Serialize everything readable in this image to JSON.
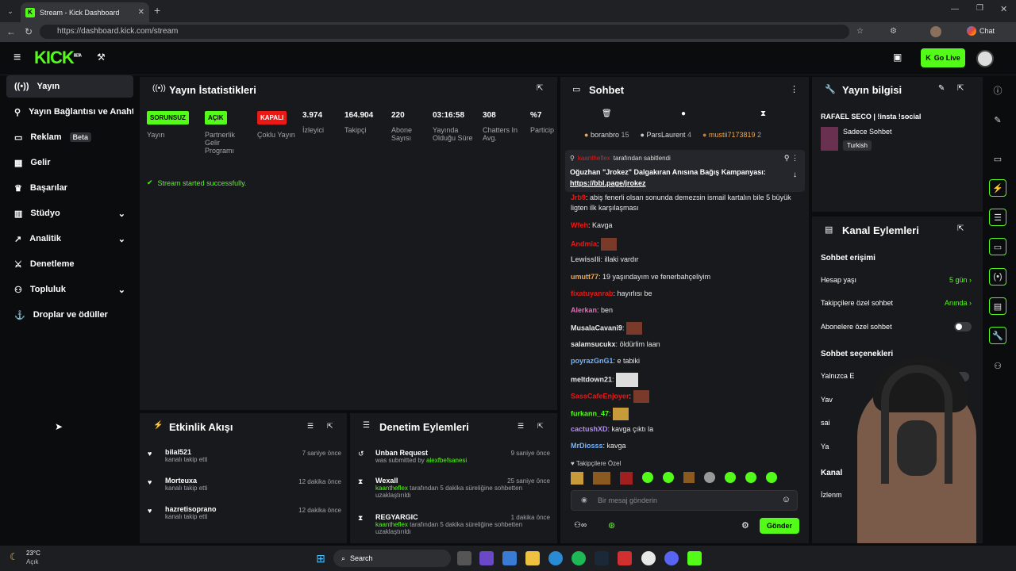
{
  "browser": {
    "tab_title": "Stream - Kick Dashboard",
    "url": "https://dashboard.kick.com/stream",
    "chat_label": "Chat"
  },
  "header": {
    "logo": "KICK",
    "logo_sup": "BETA",
    "go_live": "Go Live"
  },
  "sidebar": {
    "items": [
      {
        "label": "Yayın",
        "icon": "broadcast-icon"
      },
      {
        "label": "Yayın Bağlantısı ve Anahtarı",
        "icon": "link-icon"
      },
      {
        "label": "Reklam",
        "icon": "ad-icon",
        "badge": "Beta"
      },
      {
        "label": "Gelir",
        "icon": "revenue-icon"
      },
      {
        "label": "Başarılar",
        "icon": "trophy-icon"
      },
      {
        "label": "Stüdyo",
        "icon": "studio-icon"
      },
      {
        "label": "Analitik",
        "icon": "analytics-icon"
      },
      {
        "label": "Denetleme",
        "icon": "moderation-icon"
      },
      {
        "label": "Topluluk",
        "icon": "community-icon"
      },
      {
        "label": "Droplar ve ödüller",
        "icon": "drops-icon"
      }
    ]
  },
  "stats": {
    "title": "Yayın İstatistikleri",
    "badges": [
      {
        "text": "SORUNSUZ",
        "label": "Yayın",
        "color": "#53fc18"
      },
      {
        "text": "AÇIK",
        "label": "Partnerlik Gelir Programı",
        "color": "#53fc18"
      },
      {
        "text": "KAPALI",
        "label": "Çoklu Yayın",
        "color": "#e91916"
      }
    ],
    "values": [
      {
        "value": "3.974",
        "label": "İzleyici"
      },
      {
        "value": "164.904",
        "label": "Takipçi"
      },
      {
        "value": "220",
        "label": "Abone Sayısı"
      },
      {
        "value": "03:16:58",
        "label": "Yayında Olduğu Süre"
      },
      {
        "value": "308",
        "label": "Chatters In Avg."
      },
      {
        "value": "%7",
        "label": "Particip"
      }
    ],
    "success": "Stream started successfully."
  },
  "activity": {
    "title": "Etkinlik Akışı",
    "items": [
      {
        "user": "bilal521",
        "action": "kanalı takip etti",
        "time": "7 saniye önce"
      },
      {
        "user": "Morteuxa",
        "action": "kanalı takip etti",
        "time": "12 dakika önce"
      },
      {
        "user": "hazretisoprano",
        "action": "kanalı takip etti",
        "time": "12 dakika önce"
      }
    ]
  },
  "moderation": {
    "title": "Denetim Eylemleri",
    "items": [
      {
        "user": "Unban Request",
        "line1": "was submitted by ",
        "actor": "alexfbefsanesi",
        "time": "9 saniye önce"
      },
      {
        "user": "Wexall",
        "actor": "kaantheflex",
        "line1": " tarafından 5 dakika süreliğine sohbetten uzaklaştırıldı",
        "time": "25 saniye önce"
      },
      {
        "user": "REGYARGIC",
        "actor": "kaantheflex",
        "line1": " tarafından 5 dakika süreliğine sohbetten uzaklaştırıldı",
        "time": "1 dakika önce"
      }
    ]
  },
  "chat": {
    "title": "Sohbet",
    "top": [
      {
        "name": "boranbro",
        "n": "15"
      },
      {
        "name": "ParsLaurent",
        "n": "4"
      },
      {
        "name": "mustii7173819",
        "n": "2"
      }
    ],
    "pinned_by": "tarafından sabitlendi",
    "pinned_text": "Oğuzhan \"Jrokez\" Dalgakıran Anısına Bağış Kampanyası:",
    "pinned_link": "https://bbl.page/jrokez",
    "messages": [
      {
        "user": "Jrb9",
        "color": "#e91916",
        "text": "abiş fenerli olsan sonunda demezsin ismail kartalın bile 5 büyük ligten ilk karşılaşması"
      },
      {
        "user": "Wfeh",
        "color": "#e91916",
        "text": "Kavga"
      },
      {
        "user": "Andmia",
        "color": "#e91916",
        "text": ""
      },
      {
        "user": "Lewisslli",
        "color": "#bcbcbc",
        "text": "illaki vardır"
      },
      {
        "user": "umutt77",
        "color": "#f0a64f",
        "text": "19 yaşındayım ve fenerbahçeliyim"
      },
      {
        "user": "fixatuyanrab",
        "color": "#e91916",
        "text": "hayırlısı be"
      },
      {
        "user": "Alerkan",
        "color": "#e86ab8",
        "text": "ben"
      },
      {
        "user": "MusalaCavani9",
        "color": "#e8e8e8",
        "text": ""
      },
      {
        "user": "salamsucukx",
        "color": "#e8e8e8",
        "text": "öldürlim laan"
      },
      {
        "user": "poyrazGnG1",
        "color": "#75b4f8",
        "text": "e tabiki"
      },
      {
        "user": "meltdown21",
        "color": "#e8e8e8",
        "text": ""
      },
      {
        "user": "SassCafeEnjoyer",
        "color": "#e91916",
        "text": ""
      },
      {
        "user": "furkann_47",
        "color": "#53fc18",
        "text": ""
      },
      {
        "user": "cactushXD",
        "color": "#b48cf8",
        "text": "kavga çıktı la"
      },
      {
        "user": "MrDiosss",
        "color": "#75b4f8",
        "text": "kavga"
      }
    ],
    "followers_only": "Takipçilere Özel",
    "placeholder": "Bir mesaj gönderin",
    "send": "Gönder"
  },
  "info": {
    "title": "Yayın bilgisi",
    "stream_title": "RAFAEL SECO | !insta !social",
    "category": "Sadece Sohbet",
    "language": "Turkish"
  },
  "channel": {
    "title": "Kanal Eylemleri",
    "access": "Sohbet erişimi",
    "rows": [
      {
        "label": "Hesap yaşı",
        "value": "5 gün"
      },
      {
        "label": "Takipçilere özel sohbet",
        "value": "Anında"
      },
      {
        "label": "Abonelere özel sohbet",
        "value": ""
      }
    ],
    "options": "Sohbet seçenekleri",
    "opt1": "Yalnızca E",
    "opt2": "Yav",
    "opt3": "sai",
    "opt4": "Ya",
    "opt5": "Kanal",
    "opt6": "İzlenm"
  },
  "taskbar": {
    "temp": "23°C",
    "weather": "Açık",
    "search": "Search"
  }
}
